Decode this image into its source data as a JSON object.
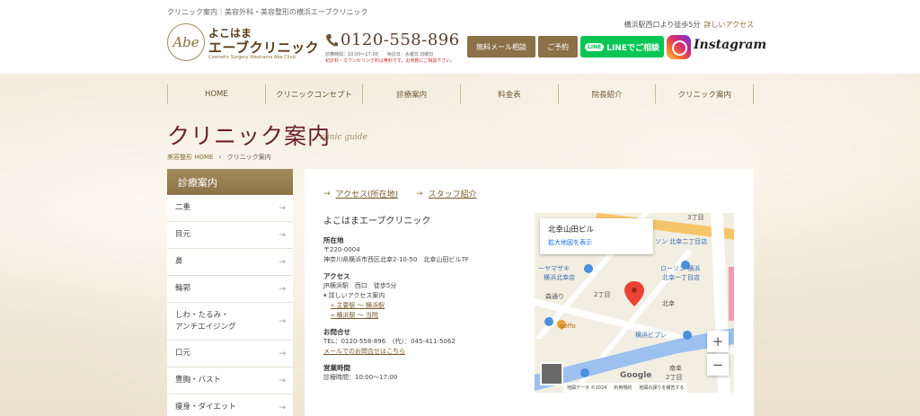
{
  "header": {
    "tagline": "クリニック案内｜美容外科・美容整形の横浜エーブクリニック",
    "logo": {
      "mark": "Abe",
      "top": "よこはま",
      "main": "エーブクリニック",
      "sub": "Cosmetic Surgery Yokohama Abe Clinic"
    },
    "phone": {
      "number": "0120-558-896",
      "hours": "診療時間：10:00〜17:00　　休診日：水曜日 日曜日",
      "note": "初診料・カウンセリング料は無料です。お気軽にご相談下さい。"
    },
    "buttons": {
      "mail": "無料メール相談",
      "reserve": "ご予約",
      "line_badge": "LINE",
      "line": "LINEでご相談",
      "instagram": "Instagram"
    },
    "access": {
      "text": "横浜駅西口より徒歩5分",
      "link": "詳しいアクセス"
    }
  },
  "nav": [
    "HOME",
    "クリニックコンセプト",
    "診療案内",
    "料金表",
    "院長紹介",
    "クリニック案内"
  ],
  "page": {
    "title": "クリニック案内",
    "title_en": "clinic guide",
    "breadcrumb": {
      "home": "美容整形 HOME",
      "sep": "›",
      "current": "クリニック案内"
    }
  },
  "sidebar": {
    "heading": "診療案内",
    "items": [
      {
        "label": "二重"
      },
      {
        "label": "目元"
      },
      {
        "label": "鼻"
      },
      {
        "label": "輪郭"
      },
      {
        "label": "しわ・たるみ・\nアンチエイジング"
      },
      {
        "label": "口元"
      },
      {
        "label": "豊胸・バスト"
      },
      {
        "label": "痩身・ダイエット"
      }
    ]
  },
  "main": {
    "subnav": [
      {
        "label": "アクセス(所在地)"
      },
      {
        "label": "スタッフ紹介"
      }
    ],
    "clinic_name": "よこはまエーブクリニック",
    "address": {
      "heading": "所在地",
      "zip": "〒220-0004",
      "street": "神奈川県横浜市西区北幸2-10-50　北幸山田ビル7F"
    },
    "access": {
      "heading": "アクセス",
      "text": "JR横浜駅　西口　徒歩5分",
      "toggle": "▾ 詳しいアクセス案内",
      "link1": "» 主要駅 ～ 横浜駅",
      "link2": "» 横浜駅 ～ 当院"
    },
    "contact": {
      "heading": "お問合せ",
      "tel": "TEL：0120-558-896　（代）：045-411-5062",
      "mail_link": "メールでのお問合せはこちら"
    },
    "hours": {
      "heading": "営業時間",
      "text": "診療時間：10:00〜17:00"
    }
  },
  "map": {
    "card_title": "北幸山田ビル",
    "card_link": "拡大地図を表示",
    "zoom_in": "+",
    "zoom_out": "−",
    "google": "Google",
    "footer": [
      "地図データ ©2024",
      "利用規約",
      "地図の誤りを報告する"
    ],
    "labels": {
      "chome3": "3丁目",
      "lawson1": "ソン 北幸二丁目店",
      "yamazaki": "ーヤマザキ",
      "yamazaki2": "横浜北幸店",
      "lawson2": "ローソン 横浜",
      "lawson3": "北幸一丁目店",
      "chome2": "2丁目",
      "chome2b": "2丁目",
      "kitasaiwai": "北幸",
      "minamisaiwai": "南幸",
      "mori": "森通り",
      "goffo": "goffo",
      "vivre": "横浜ビブレ"
    }
  }
}
